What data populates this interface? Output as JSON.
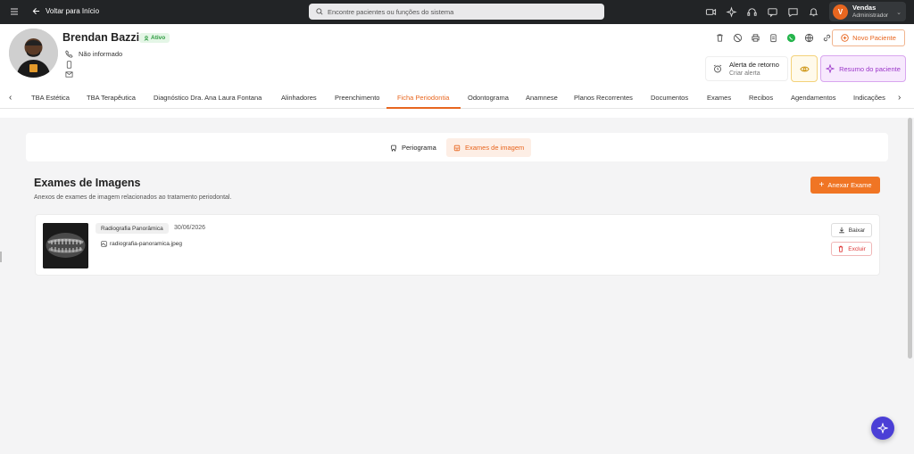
{
  "topbar": {
    "back_label": "Voltar para Início",
    "search_placeholder": "Encontre pacientes ou funções do sistema",
    "user_initial": "V",
    "user_name": "Vendas",
    "user_role": "Administrador"
  },
  "patient": {
    "name": "Brendan Bazzi",
    "status": "Ativo",
    "phone": "Não informado",
    "alert_title": "Alerta de retorno",
    "alert_action": "Criar alerta",
    "new_patient_label": "Novo Paciente",
    "summary_label": "Resumo do paciente"
  },
  "tabs": [
    "TBA Estética",
    "TBA Terapêutica",
    "Diagnóstico Dra. Ana Laura Fontana",
    "Alinhadores",
    "Preenchimento",
    "Ficha Periodontia",
    "Odontograma",
    "Anamnese",
    "Planos Recorrentes",
    "Documentos",
    "Exames",
    "Recibos",
    "Agendamentos",
    "Indicações"
  ],
  "active_tab": "Ficha Periodontia",
  "segments": {
    "periograma": "Periograma",
    "exames": "Exames de imagem"
  },
  "section": {
    "title": "Exames de Imagens",
    "subtitle": "Anexos de exames de imagem relacionados ao tratamento periodontal.",
    "attach_label": "Anexar Exame"
  },
  "exam": {
    "type": "Radiografia Panorâmica",
    "date": "30/06/2026",
    "file": "radiografia-panoramica.jpeg",
    "download_label": "Baixar",
    "delete_label": "Excluir"
  },
  "colors": {
    "accent": "#e8661f",
    "topbar": "#222426",
    "summary": "#9b36c9",
    "fab": "#4b3fd6"
  }
}
